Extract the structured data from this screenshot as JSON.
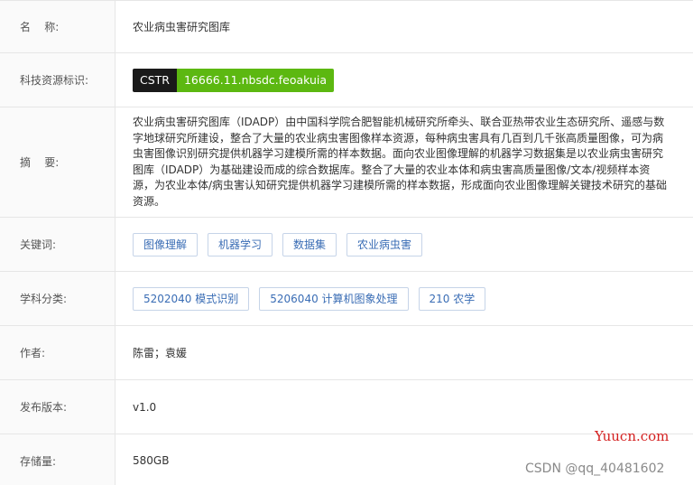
{
  "fields": {
    "name": {
      "label": "名    称:",
      "value": "农业病虫害研究图库"
    },
    "cstr": {
      "label": "科技资源标识:",
      "prefix": "CSTR",
      "id": "16666.11.nbsdc.feoakuia"
    },
    "abstract": {
      "label": "摘    要:",
      "value": "农业病虫害研究图库（IDADP）由中国科学院合肥智能机械研究所牵头、联合亚热带农业生态研究所、遥感与数字地球研究所建设，整合了大量的农业病虫害图像样本资源，每种病虫害具有几百到几千张高质量图像，可为病虫害图像识别研究提供机器学习建模所需的样本数据。面向农业图像理解的机器学习数据集是以农业病虫害研究图库（IDADP）为基础建设而成的综合数据库。整合了大量的农业本体和病虫害高质量图像/文本/视频样本资源，为农业本体/病虫害认知研究提供机器学习建模所需的样本数据，形成面向农业图像理解关键技术研究的基础资源。"
    },
    "keywords": {
      "label": "关键词:",
      "items": [
        "图像理解",
        "机器学习",
        "数据集",
        "农业病虫害"
      ]
    },
    "subjects": {
      "label": "学科分类:",
      "items": [
        "5202040 模式识别",
        "5206040 计算机图象处理",
        "210 农学"
      ]
    },
    "authors": {
      "label": "作者:",
      "value": "陈雷；袁媛"
    },
    "version": {
      "label": "发布版本:",
      "value": "v1.0"
    },
    "storage": {
      "label": "存储量:",
      "value": "580GB"
    }
  },
  "watermarks": {
    "site": "Yuucn.com",
    "author": "CSDN @qq_40481602"
  },
  "colors": {
    "cstr_prefix_bg": "#1a1a1a",
    "cstr_id_bg": "#5cb811",
    "tag_text": "#3a6db5",
    "watermark_red": "#d42020"
  }
}
